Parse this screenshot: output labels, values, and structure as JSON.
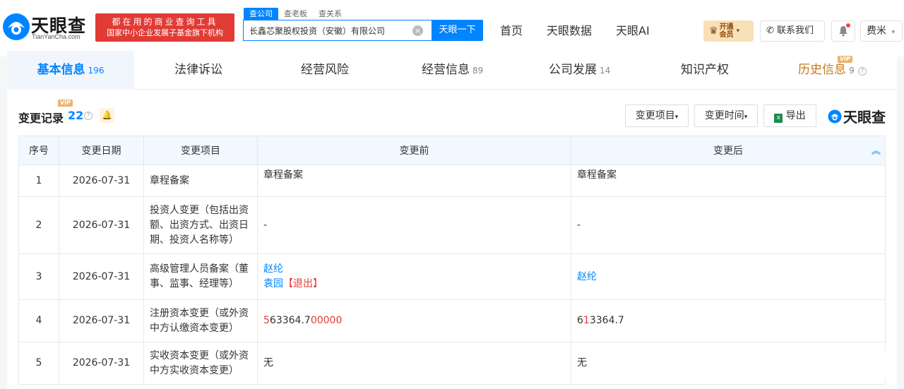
{
  "brand": {
    "name_cn": "天眼查",
    "name_en": "TianYanCha.com"
  },
  "slogan": {
    "line1": "都在用的商业查询工具",
    "line2": "国家中小企业发展子基金旗下机构"
  },
  "search": {
    "tabs": [
      "查公司",
      "查老板",
      "查关系"
    ],
    "value": "长鑫芯聚股权投资（安徽）有限公司",
    "button": "天眼一下"
  },
  "nav": [
    "首页",
    "天眼数据",
    "天眼AI"
  ],
  "vip": {
    "line1": "开通",
    "line2": "会员"
  },
  "contact": "联系我们",
  "user": "费米",
  "tabs": [
    {
      "label": "基本信息",
      "count": "196"
    },
    {
      "label": "法律诉讼",
      "count": ""
    },
    {
      "label": "经营风险",
      "count": ""
    },
    {
      "label": "经营信息",
      "count": "89"
    },
    {
      "label": "公司发展",
      "count": "14"
    },
    {
      "label": "知识产权",
      "count": ""
    },
    {
      "label": "历史信息",
      "count": "9",
      "badge": "VIP"
    }
  ],
  "section": {
    "title": "变更记录",
    "badge": "VIP",
    "count": "22",
    "filter_item": "变更项目",
    "filter_time": "变更时间",
    "export": "导出",
    "brand": "天眼查"
  },
  "table": {
    "headers": [
      "序号",
      "变更日期",
      "变更项目",
      "变更前",
      "变更后"
    ],
    "rows": [
      {
        "num": "1",
        "date": "2026-07-31",
        "item": "章程备案",
        "before": "章程备案",
        "after": "章程备案"
      },
      {
        "num": "2",
        "date": "2026-07-31",
        "item": "投资人变更（包括出资额、出资方式、出资日期、投资人名称等）",
        "before": "-",
        "after": "-"
      },
      {
        "num": "3",
        "date": "2026-07-31",
        "item": "高级管理人员备案（董事、监事、经理等）",
        "before_1": "赵纶",
        "before_2": "袁园",
        "before_2_tag": "【退出】",
        "after": "赵纶"
      },
      {
        "num": "4",
        "date": "2026-07-31",
        "item": "注册资本变更（或外资中方认缴资本变更）",
        "before_a": "5",
        "before_b": "63364.7",
        "before_c": "00000",
        "after_a": "6",
        "after_b": "13364.7"
      },
      {
        "num": "5",
        "date": "2026-07-31",
        "item": "实收资本变更（或外资中方实收资本变更）",
        "before": "无",
        "after": "无"
      }
    ]
  }
}
